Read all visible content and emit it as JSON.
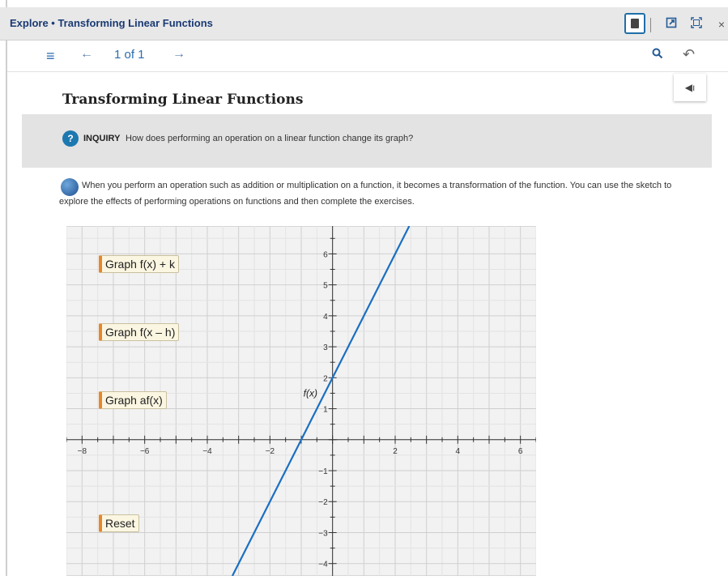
{
  "titlebar": {
    "title": "Explore • Transforming Linear Functions",
    "calculator_icon": "calculator-icon",
    "popout_icon": "popout-icon",
    "expand_icon": "expand-icon",
    "close_label": "×"
  },
  "navbar": {
    "menu_icon": "≡",
    "prev_icon": "←",
    "page_indicator": "1 of 1",
    "next_icon": "→",
    "search_icon": "search-icon",
    "back_icon": "↶"
  },
  "page": {
    "title": "Transforming Linear Functions",
    "speaker_icon": "speaker-icon",
    "inquiry": {
      "label": "INQUIRY",
      "question": "How does performing an operation on a linear function change its graph?"
    },
    "paragraph": "When you perform an operation such as addition or multiplication on a function, it becomes a transformation of the function. You can use the sketch to explore the effects of performing operations on functions and then complete the exercises."
  },
  "graph": {
    "buttons": [
      "Graph f(x) + k",
      "Graph f(x – h)",
      "Graph af(x)",
      "Reset"
    ],
    "function_label": "f(x)",
    "x_ticks": [
      "−8",
      "−6",
      "−4",
      "−2",
      "2",
      "4",
      "6"
    ],
    "y_ticks": [
      "6",
      "5",
      "4",
      "3",
      "2",
      "1",
      "−1",
      "−2",
      "−3",
      "−4"
    ],
    "line_color": "#1a6fc2",
    "x_range": [
      -8.5,
      6.5
    ],
    "y_range": [
      -4.4,
      6.9
    ],
    "line": {
      "slope": 2,
      "intercept": 2
    }
  }
}
